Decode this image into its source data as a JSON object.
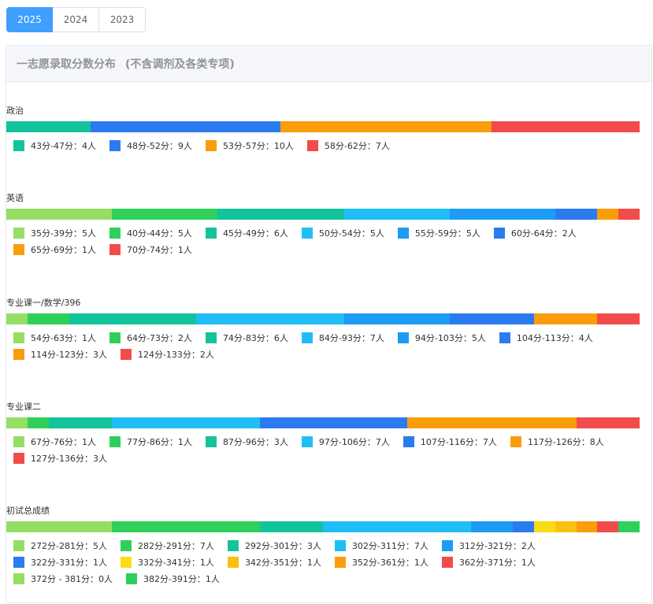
{
  "year_tabs": [
    {
      "label": "2025",
      "active": true
    },
    {
      "label": "2024",
      "active": false
    },
    {
      "label": "2023",
      "active": false
    }
  ],
  "card": {
    "title": "一志愿录取分数分布",
    "subtitle": "(不含调剂及各类专项)"
  },
  "colors": {
    "light_green": "#95de64",
    "green": "#2fcf5b",
    "teal": "#13c39b",
    "sky": "#21bdf7",
    "blue": "#1c9cf2",
    "royal": "#2b7bf0",
    "yellow": "#fadb14",
    "gold": "#fbbf11",
    "orange": "#fa9d0a",
    "red": "#f24b4b"
  },
  "subjects": [
    {
      "name": "政治",
      "ranges": [
        {
          "label": "43分-47分：4人",
          "count": 4,
          "color": "#13c39b"
        },
        {
          "label": "48分-52分：9人",
          "count": 9,
          "color": "#2b7bf0"
        },
        {
          "label": "53分-57分：10人",
          "count": 10,
          "color": "#fa9d0a"
        },
        {
          "label": "58分-62分：7人",
          "count": 7,
          "color": "#f24b4b"
        }
      ]
    },
    {
      "name": "英语",
      "ranges": [
        {
          "label": "35分-39分：5人",
          "count": 5,
          "color": "#95de64"
        },
        {
          "label": "40分-44分：5人",
          "count": 5,
          "color": "#2fcf5b"
        },
        {
          "label": "45分-49分：6人",
          "count": 6,
          "color": "#13c39b"
        },
        {
          "label": "50分-54分：5人",
          "count": 5,
          "color": "#21bdf7"
        },
        {
          "label": "55分-59分：5人",
          "count": 5,
          "color": "#1c9cf2"
        },
        {
          "label": "60分-64分：2人",
          "count": 2,
          "color": "#2b7bf0"
        },
        {
          "label": "65分-69分：1人",
          "count": 1,
          "color": "#fa9d0a"
        },
        {
          "label": "70分-74分：1人",
          "count": 1,
          "color": "#f24b4b"
        }
      ]
    },
    {
      "name": "专业课一/数学/396",
      "ranges": [
        {
          "label": "54分-63分：1人",
          "count": 1,
          "color": "#95de64"
        },
        {
          "label": "64分-73分：2人",
          "count": 2,
          "color": "#2fcf5b"
        },
        {
          "label": "74分-83分：6人",
          "count": 6,
          "color": "#13c39b"
        },
        {
          "label": "84分-93分：7人",
          "count": 7,
          "color": "#21bdf7"
        },
        {
          "label": "94分-103分：5人",
          "count": 5,
          "color": "#1c9cf2"
        },
        {
          "label": "104分-113分：4人",
          "count": 4,
          "color": "#2b7bf0"
        },
        {
          "label": "114分-123分：3人",
          "count": 3,
          "color": "#fa9d0a"
        },
        {
          "label": "124分-133分：2人",
          "count": 2,
          "color": "#f24b4b"
        }
      ]
    },
    {
      "name": "专业课二",
      "ranges": [
        {
          "label": "67分-76分：1人",
          "count": 1,
          "color": "#95de64"
        },
        {
          "label": "77分-86分：1人",
          "count": 1,
          "color": "#2fcf5b"
        },
        {
          "label": "87分-96分：3人",
          "count": 3,
          "color": "#13c39b"
        },
        {
          "label": "97分-106分：7人",
          "count": 7,
          "color": "#21bdf7"
        },
        {
          "label": "107分-116分：7人",
          "count": 7,
          "color": "#2b7bf0"
        },
        {
          "label": "117分-126分：8人",
          "count": 8,
          "color": "#fa9d0a"
        },
        {
          "label": "127分-136分：3人",
          "count": 3,
          "color": "#f24b4b"
        }
      ]
    },
    {
      "name": "初试总成绩",
      "ranges": [
        {
          "label": "272分-281分：5人",
          "count": 5,
          "color": "#95de64"
        },
        {
          "label": "282分-291分：7人",
          "count": 7,
          "color": "#2fcf5b"
        },
        {
          "label": "292分-301分：3人",
          "count": 3,
          "color": "#13c39b"
        },
        {
          "label": "302分-311分：7人",
          "count": 7,
          "color": "#21bdf7"
        },
        {
          "label": "312分-321分：2人",
          "count": 2,
          "color": "#1c9cf2"
        },
        {
          "label": "322分-331分：1人",
          "count": 1,
          "color": "#2b7bf0"
        },
        {
          "label": "332分-341分：1人",
          "count": 1,
          "color": "#fadb14"
        },
        {
          "label": "342分-351分：1人",
          "count": 1,
          "color": "#fbbf11"
        },
        {
          "label": "352分-361分：1人",
          "count": 1,
          "color": "#fa9d0a"
        },
        {
          "label": "362分-371分：1人",
          "count": 1,
          "color": "#f24b4b"
        },
        {
          "label": "372分 - 381分：0人",
          "count": 0,
          "color": "#95de64"
        },
        {
          "label": "382分-391分：1人",
          "count": 1,
          "color": "#2fcf5b"
        }
      ]
    }
  ]
}
